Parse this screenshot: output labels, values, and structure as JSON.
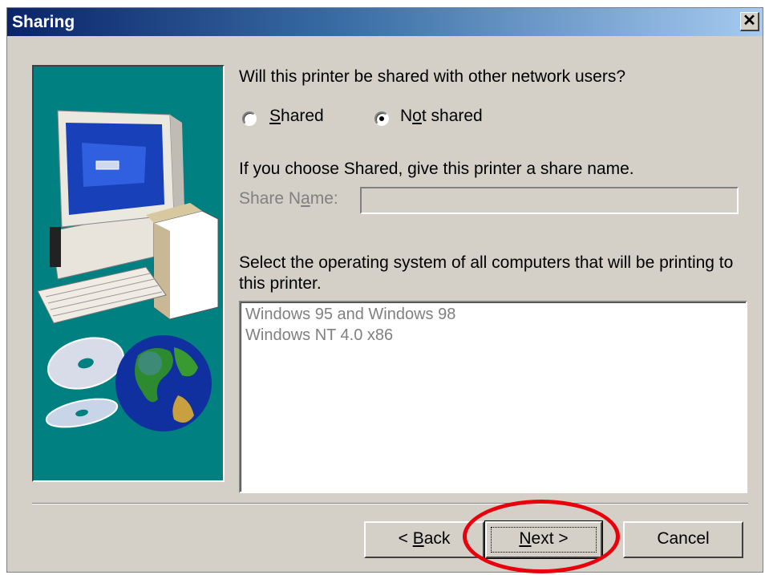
{
  "window": {
    "title": "Sharing",
    "close_symbol": "✕"
  },
  "question": "Will this printer be shared with other network users?",
  "radios": [
    {
      "label_pre": "",
      "label_u": "S",
      "label_post": "hared",
      "selected": false
    },
    {
      "label_pre": "N",
      "label_u": "o",
      "label_post": "t shared",
      "selected": true
    }
  ],
  "share_hint": "If you choose Shared, give this printer a share name.",
  "share_name": {
    "label_pre": "Share N",
    "label_u": "a",
    "label_post": "me:",
    "value": "",
    "disabled": true
  },
  "os_prompt": "Select the operating system of all computers that will be printing to this printer.",
  "os_list": [
    "Windows 95 and Windows 98",
    "Windows NT 4.0 x86"
  ],
  "buttons": {
    "back": {
      "label_pre": "< ",
      "label_u": "B",
      "label_post": "ack"
    },
    "next": {
      "label_pre": "",
      "label_u": "N",
      "label_post": "ext >"
    },
    "cancel": {
      "label": "Cancel"
    }
  },
  "colors": {
    "dialog_bg": "#d4d0c8",
    "title_gradient_start": "#0a246a",
    "art_bg": "#008080",
    "annotation": "#e8000b"
  },
  "icons": {
    "art": "computer-globe-cd-illustration",
    "close": "close-icon"
  }
}
